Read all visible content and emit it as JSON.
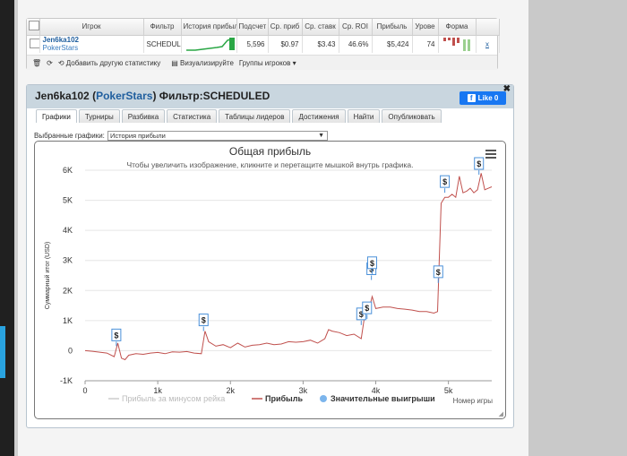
{
  "stats_table": {
    "headers": [
      "Игрок",
      "Фильтр",
      "История прибыли",
      "Подсчет",
      "Ср. приб",
      "Ср. ставк",
      "Ср. ROI",
      "Прибыль",
      "Урове",
      "Форма"
    ],
    "row": {
      "player": "Jen6ka102",
      "site": "PokerStars",
      "filter": "SCHEDUL",
      "count": "5,596",
      "avg_profit": "$0.97",
      "avg_stake": "$3.43",
      "avg_roi": "46.6%",
      "profit": "$5,424",
      "level": "74",
      "remove": "x"
    },
    "toolbar": {
      "add_label": "Добавить другую статистику",
      "visualize_label": "Визуализируйте",
      "groups_label": "Группы игроков"
    }
  },
  "panel": {
    "player": "Jen6ka102",
    "site": "PokerStars",
    "filter_label": "Фильтр:",
    "filter_value": "SCHEDULED",
    "like_label": "Like 0",
    "tabs": [
      "Графики",
      "Турниры",
      "Разбивка",
      "Статистика",
      "Таблицы лидеров",
      "Достижения",
      "Найти",
      "Опубликовать"
    ],
    "select_label": "Выбранные графики:",
    "select_value": "История прибыли"
  },
  "chart_data": {
    "type": "line",
    "title": "Общая прибыль",
    "subtitle": "Чтобы увеличить изображение, кликните и перетащите мышкой внутрь графика.",
    "ylabel": "Суммарный итог (USD)",
    "xlabel": "Номер игры",
    "y_ticks": [
      "6K",
      "5K",
      "4K",
      "3K",
      "2K",
      "1K",
      "0",
      "-1K"
    ],
    "x_ticks": [
      "0",
      "1k",
      "2k",
      "3k",
      "4k",
      "5k"
    ],
    "ylim": [
      -1000,
      6000
    ],
    "xlim": [
      0,
      5596
    ],
    "legend": [
      "Прибыль за минусом рейка",
      "Прибыль",
      "Значительные выигрыши"
    ],
    "series": [
      {
        "name": "Прибыль",
        "color": "#c0504d",
        "x": [
          0,
          100,
          200,
          300,
          400,
          450,
          500,
          550,
          600,
          700,
          800,
          900,
          1000,
          1100,
          1200,
          1300,
          1400,
          1500,
          1600,
          1650,
          1700,
          1800,
          1900,
          2000,
          2100,
          2200,
          2300,
          2400,
          2500,
          2600,
          2700,
          2800,
          2900,
          3000,
          3100,
          3200,
          3300,
          3350,
          3400,
          3500,
          3600,
          3700,
          3800,
          3850,
          3900,
          3950,
          4000,
          4100,
          4200,
          4300,
          4400,
          4500,
          4600,
          4700,
          4800,
          4850,
          4900,
          4950,
          5000,
          5050,
          5100,
          5150,
          5200,
          5250,
          5300,
          5350,
          5400,
          5450,
          5500,
          5550,
          5596
        ],
        "y": [
          0,
          -20,
          -50,
          -80,
          -200,
          250,
          -250,
          -300,
          -150,
          -100,
          -120,
          -80,
          -60,
          -100,
          -40,
          -50,
          -30,
          -80,
          -100,
          650,
          300,
          150,
          200,
          100,
          250,
          120,
          180,
          200,
          250,
          200,
          220,
          300,
          280,
          300,
          350,
          250,
          400,
          700,
          650,
          600,
          500,
          550,
          400,
          1200,
          1300,
          1800,
          1400,
          1450,
          1450,
          1400,
          1380,
          1350,
          1300,
          1300,
          1250,
          1300,
          4900,
          5100,
          5100,
          5200,
          5100,
          5800,
          5250,
          5300,
          5400,
          5250,
          5350,
          5900,
          5350,
          5400,
          5450
        ]
      }
    ],
    "big_wins": {
      "label": "$",
      "x": [
        430,
        1630,
        3800,
        3880,
        3940,
        3950,
        4860,
        4950,
        5420
      ],
      "y": [
        300,
        800,
        1000,
        1200,
        2500,
        2700,
        2400,
        5400,
        6000
      ]
    }
  }
}
